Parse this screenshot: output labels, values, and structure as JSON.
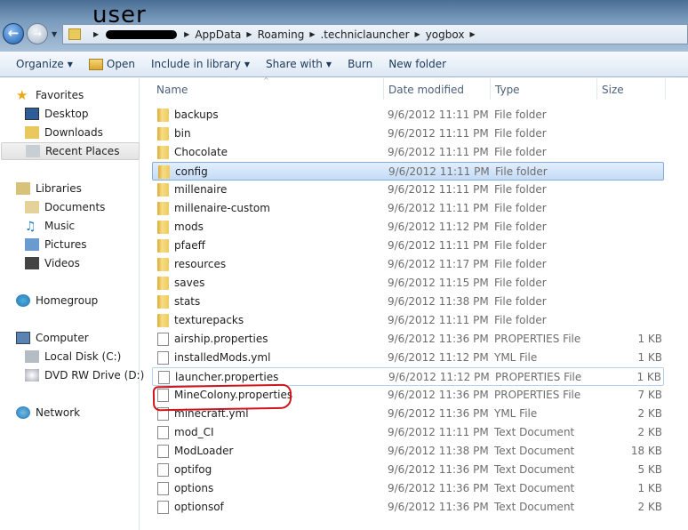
{
  "annotation": "user",
  "address": {
    "segments": [
      "AppData",
      "Roaming",
      ".techniclauncher",
      "yogbox"
    ]
  },
  "toolbar": {
    "organize": "Organize",
    "open": "Open",
    "include": "Include in library",
    "share": "Share with",
    "burn": "Burn",
    "new_folder": "New folder"
  },
  "sidebar": {
    "favorites": "Favorites",
    "desktop": "Desktop",
    "downloads": "Downloads",
    "recent": "Recent Places",
    "libraries": "Libraries",
    "documents": "Documents",
    "music": "Music",
    "pictures": "Pictures",
    "videos": "Videos",
    "homegroup": "Homegroup",
    "computer": "Computer",
    "local_disk": "Local Disk (C:)",
    "dvd": "DVD RW Drive (D:)",
    "network": "Network"
  },
  "columns": {
    "name": "Name",
    "date": "Date modified",
    "type": "Type",
    "size": "Size"
  },
  "files": [
    {
      "name": "backups",
      "date": "9/6/2012 11:11 PM",
      "type": "File folder",
      "size": "",
      "kind": "folder"
    },
    {
      "name": "bin",
      "date": "9/6/2012 11:11 PM",
      "type": "File folder",
      "size": "",
      "kind": "folder"
    },
    {
      "name": "Chocolate",
      "date": "9/6/2012 11:11 PM",
      "type": "File folder",
      "size": "",
      "kind": "folder"
    },
    {
      "name": "config",
      "date": "9/6/2012 11:11 PM",
      "type": "File folder",
      "size": "",
      "kind": "folder",
      "selected": true
    },
    {
      "name": "millenaire",
      "date": "9/6/2012 11:11 PM",
      "type": "File folder",
      "size": "",
      "kind": "folder"
    },
    {
      "name": "millenaire-custom",
      "date": "9/6/2012 11:11 PM",
      "type": "File folder",
      "size": "",
      "kind": "folder"
    },
    {
      "name": "mods",
      "date": "9/6/2012 11:12 PM",
      "type": "File folder",
      "size": "",
      "kind": "folder"
    },
    {
      "name": "pfaeff",
      "date": "9/6/2012 11:11 PM",
      "type": "File folder",
      "size": "",
      "kind": "folder"
    },
    {
      "name": "resources",
      "date": "9/6/2012 11:17 PM",
      "type": "File folder",
      "size": "",
      "kind": "folder"
    },
    {
      "name": "saves",
      "date": "9/6/2012 11:15 PM",
      "type": "File folder",
      "size": "",
      "kind": "folder"
    },
    {
      "name": "stats",
      "date": "9/6/2012 11:38 PM",
      "type": "File folder",
      "size": "",
      "kind": "folder"
    },
    {
      "name": "texturepacks",
      "date": "9/6/2012 11:11 PM",
      "type": "File folder",
      "size": "",
      "kind": "folder"
    },
    {
      "name": "airship.properties",
      "date": "9/6/2012 11:36 PM",
      "type": "PROPERTIES File",
      "size": "1 KB",
      "kind": "file"
    },
    {
      "name": "installedMods.yml",
      "date": "9/6/2012 11:12 PM",
      "type": "YML File",
      "size": "1 KB",
      "kind": "file"
    },
    {
      "name": "launcher.properties",
      "date": "9/6/2012 11:12 PM",
      "type": "PROPERTIES File",
      "size": "1 KB",
      "kind": "file",
      "hover": true
    },
    {
      "name": "MineColony.properties",
      "date": "9/6/2012 11:36 PM",
      "type": "PROPERTIES File",
      "size": "7 KB",
      "kind": "file"
    },
    {
      "name": "minecraft.yml",
      "date": "9/6/2012 11:36 PM",
      "type": "YML File",
      "size": "2 KB",
      "kind": "file"
    },
    {
      "name": "mod_CI",
      "date": "9/6/2012 11:11 PM",
      "type": "Text Document",
      "size": "2 KB",
      "kind": "file"
    },
    {
      "name": "ModLoader",
      "date": "9/6/2012 11:38 PM",
      "type": "Text Document",
      "size": "18 KB",
      "kind": "file"
    },
    {
      "name": "optifog",
      "date": "9/6/2012 11:36 PM",
      "type": "Text Document",
      "size": "5 KB",
      "kind": "file"
    },
    {
      "name": "options",
      "date": "9/6/2012 11:36 PM",
      "type": "Text Document",
      "size": "1 KB",
      "kind": "file"
    },
    {
      "name": "optionsof",
      "date": "9/6/2012 11:36 PM",
      "type": "Text Document",
      "size": "2 KB",
      "kind": "file"
    }
  ],
  "colors": {
    "selection": "#c4dcf6",
    "annotation": "#d0161c"
  }
}
